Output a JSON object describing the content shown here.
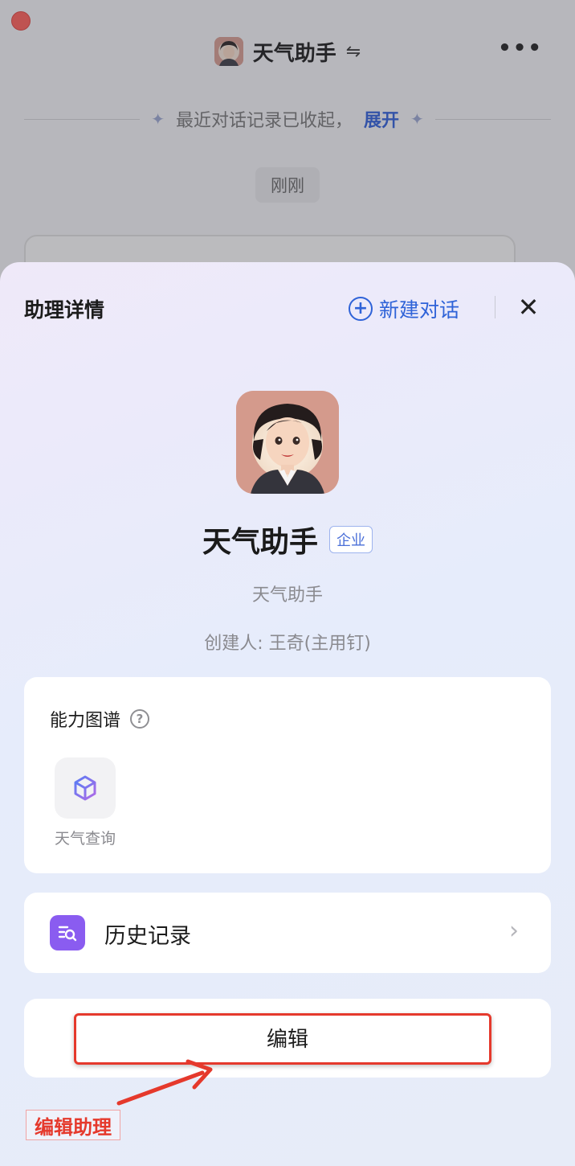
{
  "chat": {
    "title": "天气助手",
    "swap_glyph": "⇋",
    "more_glyph": "•••",
    "collapsed_text": "最近对话记录已收起，",
    "expand_label": "展开",
    "sparkle_glyph": "✦",
    "time_label": "刚刚"
  },
  "sheet": {
    "title": "助理详情",
    "new_chat_label": "新建对话",
    "plus_glyph": "+",
    "close_glyph": "✕",
    "assistant": {
      "name": "天气助手",
      "badge": "企业",
      "description": "天气助手",
      "creator": "创建人: 王奇(主用钉)"
    },
    "abilities": {
      "title": "能力图谱",
      "help_glyph": "?",
      "skills": [
        {
          "label": "天气查询",
          "icon": "cube-icon"
        }
      ]
    },
    "history": {
      "label": "历史记录",
      "icon": "search-list-icon",
      "chevron_glyph": "›"
    },
    "edit_label": "编辑"
  },
  "annotation": {
    "text": "编辑助理",
    "color": "#e5392c"
  },
  "colors": {
    "accent_blue": "#2f63d8",
    "purple": "#8a5cf0",
    "close_red": "#ff5f57"
  }
}
